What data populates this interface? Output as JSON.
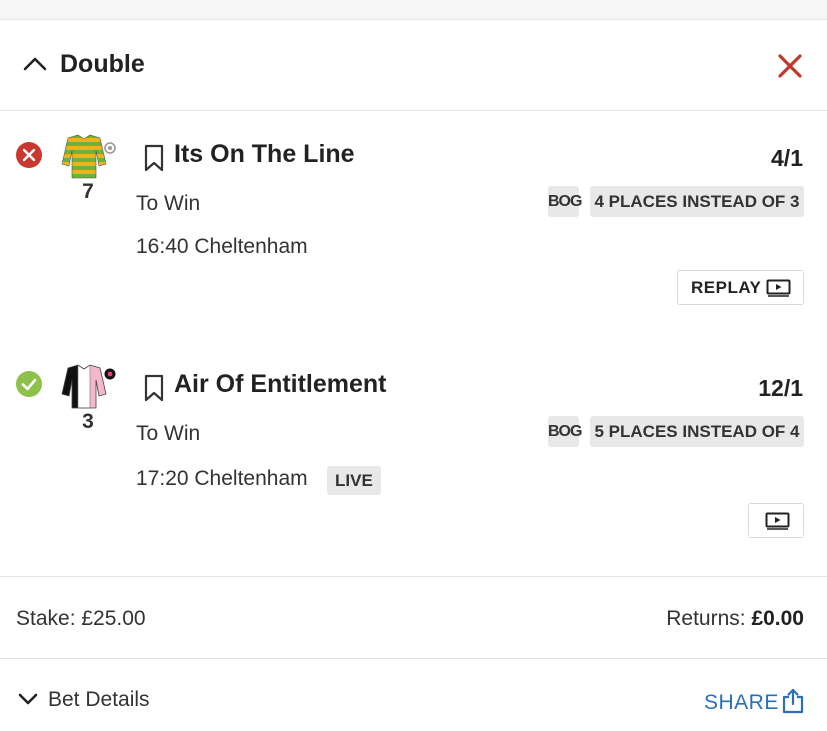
{
  "header": {
    "title": "Double",
    "collapse_icon": "chevron-up-icon",
    "close_icon": "close-icon"
  },
  "legs": [
    {
      "status": "lost",
      "status_icon": "cross-circle-icon",
      "cloth_number": "7",
      "runner_name": "Its On The Line",
      "odds": "4/1",
      "market": "To Win",
      "race": "16:40 Cheltenham",
      "bog": "BOG",
      "places_tag": "4 PLACES INSTEAD OF 3",
      "replay_label": "REPLAY"
    },
    {
      "status": "won",
      "status_icon": "check-circle-icon",
      "cloth_number": "3",
      "runner_name": "Air Of Entitlement",
      "odds": "12/1",
      "market": "To Win",
      "race": "17:20 Cheltenham",
      "live_badge": "LIVE",
      "bog": "BOG",
      "places_tag": "5 PLACES INSTEAD OF 4"
    }
  ],
  "summary": {
    "stake_text": "Stake: £25.00",
    "returns_label": "Returns:",
    "returns_value": "£0.00"
  },
  "footer": {
    "bet_details_label": "Bet Details",
    "share_label": "SHARE"
  },
  "colors": {
    "lost": "#c8382e",
    "won": "#8dc149",
    "close": "#c0392b",
    "share": "#2b6fb6",
    "tag_bg": "#e8e8e8"
  }
}
